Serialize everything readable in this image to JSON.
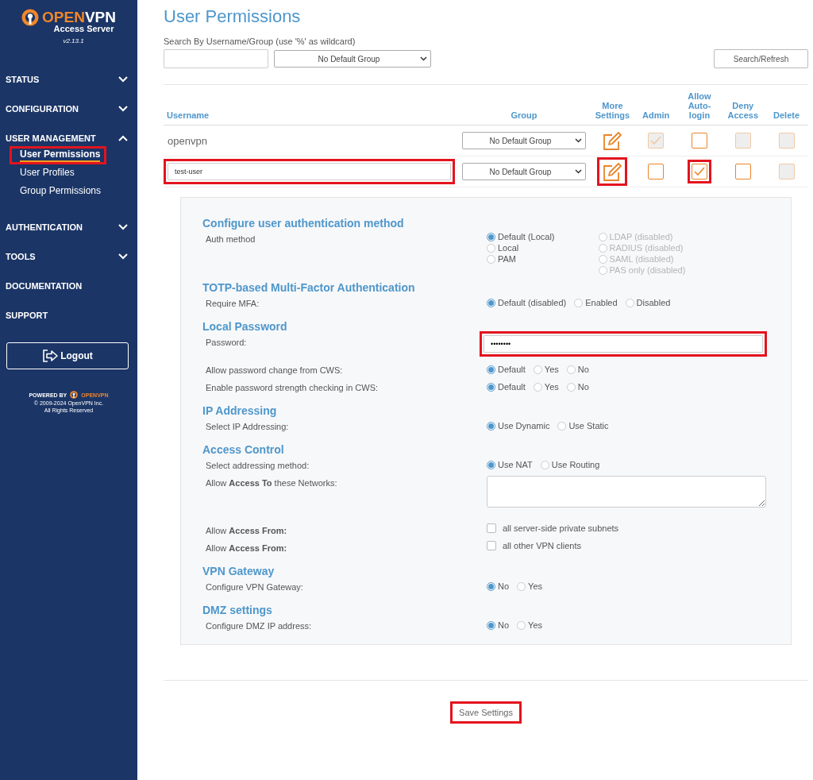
{
  "sidebar": {
    "logo": {
      "brand_open": "OPEN",
      "brand_vpn": "VPN",
      "subtitle": "Access Server",
      "version": "v2.13.1"
    },
    "nav": [
      {
        "label": "STATUS",
        "kind": "section",
        "expanded": false
      },
      {
        "label": "CONFIGURATION",
        "kind": "section",
        "expanded": false
      },
      {
        "label": "USER  MANAGEMENT",
        "kind": "section",
        "expanded": true,
        "children": [
          {
            "label": "User Permissions",
            "selected": true,
            "highlighted": true
          },
          {
            "label": "User Profiles",
            "selected": false,
            "highlighted": false
          },
          {
            "label": "Group Permissions",
            "selected": false,
            "highlighted": false
          }
        ]
      },
      {
        "label": "AUTHENTICATION",
        "kind": "section",
        "expanded": false
      },
      {
        "label": "TOOLS",
        "kind": "section",
        "expanded": false
      },
      {
        "label": "DOCUMENTATION",
        "kind": "link"
      },
      {
        "label": "SUPPORT",
        "kind": "link"
      }
    ],
    "logout": "Logout",
    "footer": {
      "powered_by": "POWERED BY",
      "brand_open": "OPEN",
      "brand_vpn": "VPN",
      "copyright": "© 2009-2024 OpenVPN Inc.",
      "rights": "All Rights Reserved"
    }
  },
  "page": {
    "title": "User Permissions",
    "search": {
      "label": "Search By Username/Group (use '%' as wildcard)",
      "group": "No Default Group",
      "button": "Search/Refresh"
    },
    "table": {
      "columns": [
        "Username",
        "Group",
        "More Settings",
        "Admin",
        "Allow Auto-login",
        "Deny Access",
        "Delete"
      ],
      "rows": [
        {
          "username": "openvpn",
          "kind": "text",
          "highlighted": false,
          "group": "No Default Group",
          "edit_highlighted": false,
          "flags": [
            {
              "checked": true,
              "disabled": true,
              "highlighted": false
            },
            {
              "checked": false,
              "disabled": false,
              "highlighted": false
            },
            {
              "checked": false,
              "disabled": true,
              "highlighted": false
            },
            {
              "checked": false,
              "disabled": true,
              "highlighted": false
            }
          ]
        },
        {
          "username": "test-user",
          "kind": "input",
          "highlighted": true,
          "group": "No Default Group",
          "edit_highlighted": true,
          "flags": [
            {
              "checked": false,
              "disabled": false,
              "highlighted": false
            },
            {
              "checked": true,
              "disabled": false,
              "highlighted": true
            },
            {
              "checked": false,
              "disabled": false,
              "highlighted": false
            },
            {
              "checked": false,
              "disabled": true,
              "highlighted": false
            }
          ]
        }
      ]
    },
    "settings": [
      {
        "title": "Configure user authentication method",
        "rows": [
          {
            "label": "Auth method",
            "kind": "radio_columns",
            "columns": [
              [
                {
                  "label": "Default (Local)",
                  "selected": true,
                  "disabled": false
                },
                {
                  "label": "Local",
                  "selected": false,
                  "disabled": false
                },
                {
                  "label": "PAM",
                  "selected": false,
                  "disabled": false
                }
              ],
              [
                {
                  "label": "LDAP (disabled)",
                  "selected": false,
                  "disabled": true
                },
                {
                  "label": "RADIUS (disabled)",
                  "selected": false,
                  "disabled": true
                },
                {
                  "label": "SAML (disabled)",
                  "selected": false,
                  "disabled": true
                },
                {
                  "label": "PAS only (disabled)",
                  "selected": false,
                  "disabled": true
                }
              ]
            ]
          }
        ]
      },
      {
        "title": "TOTP-based Multi-Factor Authentication",
        "rows": [
          {
            "label": "Require MFA:",
            "kind": "radio",
            "options": [
              {
                "label": "Default (disabled)",
                "selected": true
              },
              {
                "label": "Enabled",
                "selected": false
              },
              {
                "label": "Disabled",
                "selected": false
              }
            ]
          }
        ]
      },
      {
        "title": "Local Password",
        "rows": [
          {
            "label": "Password:",
            "kind": "password",
            "value": "••••••••",
            "highlighted": true
          },
          {
            "label": "Allow password change from CWS:",
            "kind": "radio",
            "options": [
              {
                "label": "Default",
                "selected": true
              },
              {
                "label": "Yes",
                "selected": false
              },
              {
                "label": "No",
                "selected": false
              }
            ]
          },
          {
            "label": "Enable password strength checking in CWS:",
            "kind": "radio",
            "options": [
              {
                "label": "Default",
                "selected": true
              },
              {
                "label": "Yes",
                "selected": false
              },
              {
                "label": "No",
                "selected": false
              }
            ]
          }
        ]
      },
      {
        "title": "IP Addressing",
        "rows": [
          {
            "label": "Select IP Addressing:",
            "kind": "radio",
            "options": [
              {
                "label": "Use Dynamic",
                "selected": true
              },
              {
                "label": "Use Static",
                "selected": false
              }
            ]
          }
        ]
      },
      {
        "title": "Access Control",
        "rows": [
          {
            "label": "Select addressing method:",
            "kind": "radio",
            "options": [
              {
                "label": "Use NAT",
                "selected": true
              },
              {
                "label": "Use Routing",
                "selected": false
              }
            ]
          },
          {
            "label": "Allow **Access To** these Networks:",
            "kind": "textarea"
          },
          {
            "label": "Allow **Access From:**",
            "kind": "checkbox",
            "text": "all server-side private subnets",
            "checked": false
          },
          {
            "label": "Allow **Access From:**",
            "kind": "checkbox",
            "text": "all other VPN clients",
            "checked": false
          }
        ]
      },
      {
        "title": "VPN Gateway",
        "rows": [
          {
            "label": "Configure VPN Gateway:",
            "kind": "radio",
            "options": [
              {
                "label": "No",
                "selected": true
              },
              {
                "label": "Yes",
                "selected": false
              }
            ]
          }
        ]
      },
      {
        "title": "DMZ settings",
        "rows": [
          {
            "label": "Configure DMZ IP address:",
            "kind": "radio",
            "options": [
              {
                "label": "No",
                "selected": true
              },
              {
                "label": "Yes",
                "selected": false
              }
            ]
          }
        ]
      }
    ],
    "save": {
      "label": "Save Settings",
      "highlighted": true
    }
  }
}
